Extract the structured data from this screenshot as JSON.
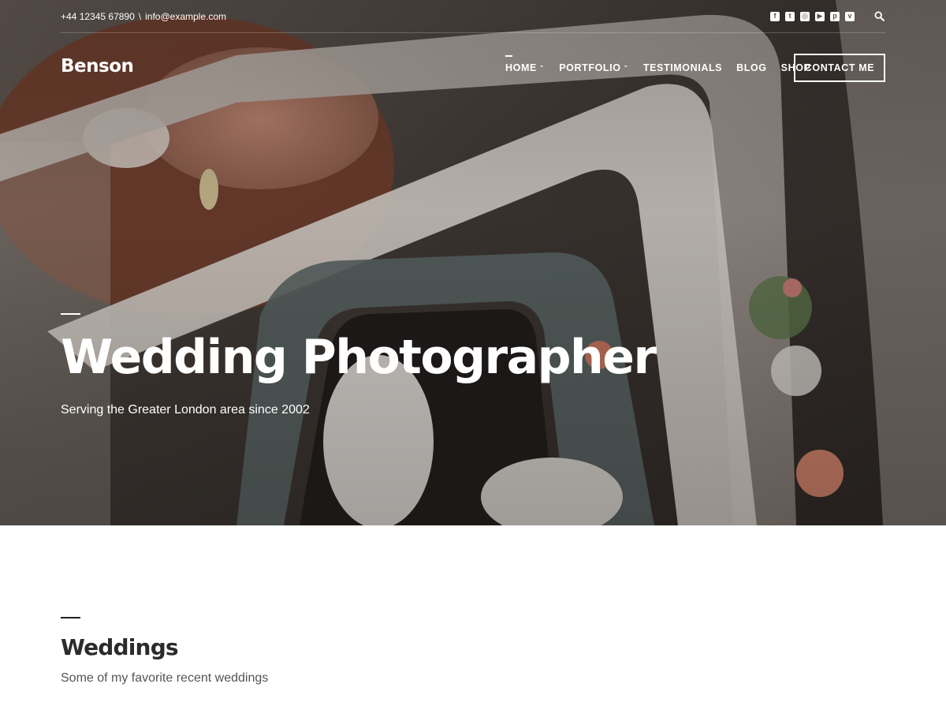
{
  "topbar": {
    "phone": "+44 12345 67890",
    "separator": "\\",
    "email": "info@example.com",
    "social": [
      {
        "icon": "facebook-icon",
        "glyph": "f"
      },
      {
        "icon": "twitter-icon",
        "glyph": "t"
      },
      {
        "icon": "instagram-icon",
        "glyph": "◎"
      },
      {
        "icon": "youtube-icon",
        "glyph": "▶"
      },
      {
        "icon": "pinterest-icon",
        "glyph": "p"
      },
      {
        "icon": "vimeo-icon",
        "glyph": "v"
      }
    ],
    "search_icon": "search-icon"
  },
  "header": {
    "logo": "Benson",
    "nav": [
      {
        "label": "HOME",
        "has_dropdown": true,
        "active": true
      },
      {
        "label": "PORTFOLIO",
        "has_dropdown": true,
        "active": false
      },
      {
        "label": "TESTIMONIALS",
        "has_dropdown": false,
        "active": false
      },
      {
        "label": "BLOG",
        "has_dropdown": false,
        "active": false
      },
      {
        "label": "SHOP",
        "has_dropdown": false,
        "active": false
      }
    ],
    "cta": "CONTACT ME"
  },
  "hero": {
    "title": "Wedding Photographer",
    "subtitle": "Serving the Greater London area since 2002"
  },
  "section": {
    "title": "Weddings",
    "subtitle": "Some of my favorite recent weddings"
  },
  "colors": {
    "hero_dark": "#3b342f",
    "text_dark": "#2b2b2b",
    "text_muted": "#555555",
    "white": "#ffffff"
  }
}
